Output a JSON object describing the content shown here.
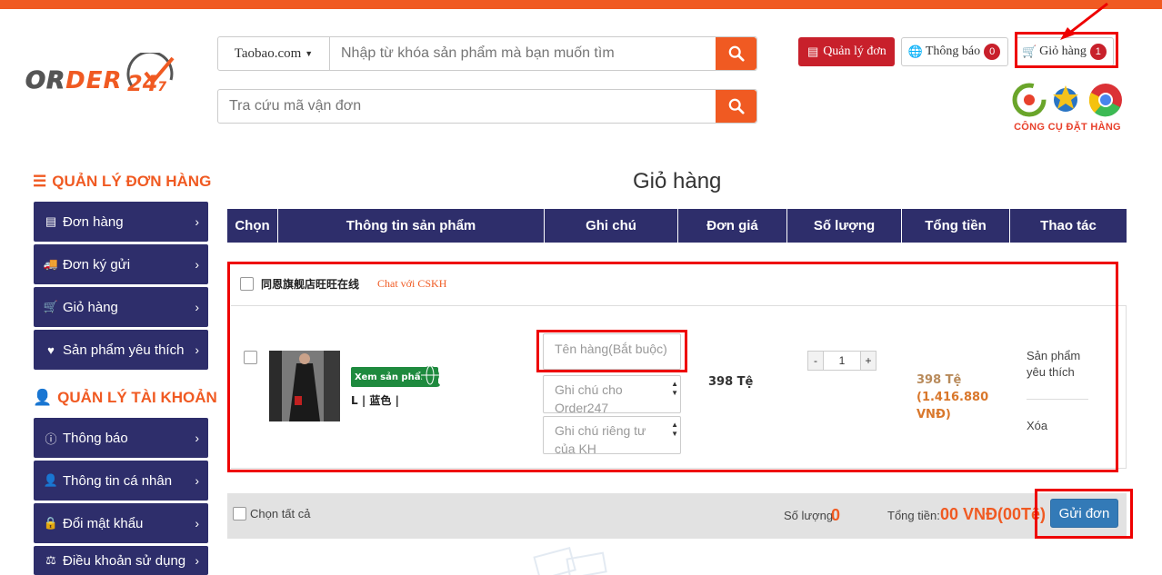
{
  "header": {
    "logo_text_a": "OR",
    "logo_text_b": "DER",
    "logo_text_c": "24",
    "logo_text_d": "7",
    "site_select": "Taobao.com",
    "search_placeholder": "Nhập từ khóa sản phẩm mà bạn muốn tìm",
    "tracking_placeholder": "Tra cứu mã vận đơn",
    "btn_quanly": "Quản lý đơn",
    "btn_thongbao": "Thông báo",
    "thongbao_count": "0",
    "btn_giohang": "Giỏ hàng",
    "giohang_count": "1",
    "tools_label": "CÔNG CỤ ĐẶT HÀNG"
  },
  "sidebar": {
    "section1_title": "QUẢN LÝ ĐƠN HÀNG",
    "section1_items": [
      {
        "label": "Đơn hàng",
        "icon": "list-icon"
      },
      {
        "label": "Đơn ký gửi",
        "icon": "truck-icon"
      },
      {
        "label": "Giỏ hàng",
        "icon": "cart-icon"
      },
      {
        "label": "Sản phẩm yêu thích",
        "icon": "heart-icon"
      }
    ],
    "section2_title": "QUẢN LÝ TÀI KHOẢN",
    "section2_items": [
      {
        "label": "Thông báo",
        "icon": "info-icon"
      },
      {
        "label": "Thông tin cá nhân",
        "icon": "user-icon"
      },
      {
        "label": "Đổi mật khẩu",
        "icon": "lock-icon"
      },
      {
        "label": "Điều khoản sử dụng",
        "icon": "gavel-icon"
      }
    ]
  },
  "main": {
    "title": "Giỏ hàng",
    "columns": [
      "Chọn",
      "Thông tin sản phẩm",
      "Ghi chú",
      "Đơn giá",
      "Số lượng",
      "Tổng tiền",
      "Thao tác"
    ],
    "shop": {
      "name": "同恩旗舰店旺旺在线",
      "chat_link": "Chat với CSKH"
    },
    "item": {
      "view_button": "Xem sản phẩm",
      "variant": "L | 蓝色 |",
      "note_required_placeholder": "Tên hàng(Bắt buộc)",
      "note_order_placeholder": "Ghi chú cho Order247",
      "note_private_placeholder": "Ghi chú riêng tư của KH",
      "unit_price": "398 Tệ",
      "quantity": "1",
      "qty_minus": "-",
      "qty_plus": "+",
      "total_cny": "398 Tệ",
      "total_vnd": "(1.416.880 VNĐ)",
      "action_favorite": "Sản phẩm yêu thích",
      "action_delete": "Xóa"
    },
    "footer": {
      "select_all": "Chọn tất cả",
      "qty_label": "Số lượng",
      "qty_value": "0",
      "total_label": "Tổng tiền:",
      "total_value": "00 VNĐ(00Tệ)",
      "send_button": "Gửi đơn"
    }
  },
  "colors": {
    "accent": "#f05a22",
    "navy": "#2e2e6b",
    "highlight": "#e00000",
    "primary_button": "#337ab7"
  }
}
